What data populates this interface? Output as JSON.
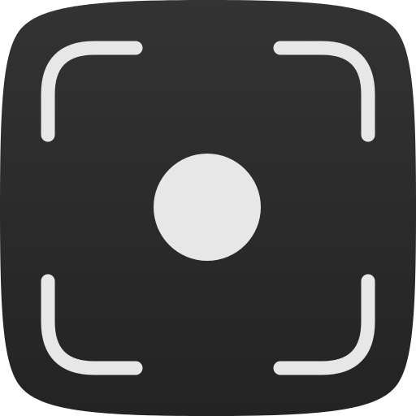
{
  "icon": {
    "name": "screen-recording-app-icon",
    "background_color": "#2b2b2b",
    "background_gradient_top": "#333333",
    "background_gradient_bottom": "#232323",
    "foreground_color": "#e7e7e7",
    "glyphs": [
      "viewfinder-corner-top-left",
      "viewfinder-corner-top-right",
      "viewfinder-corner-bottom-left",
      "viewfinder-corner-bottom-right",
      "record-dot"
    ]
  }
}
